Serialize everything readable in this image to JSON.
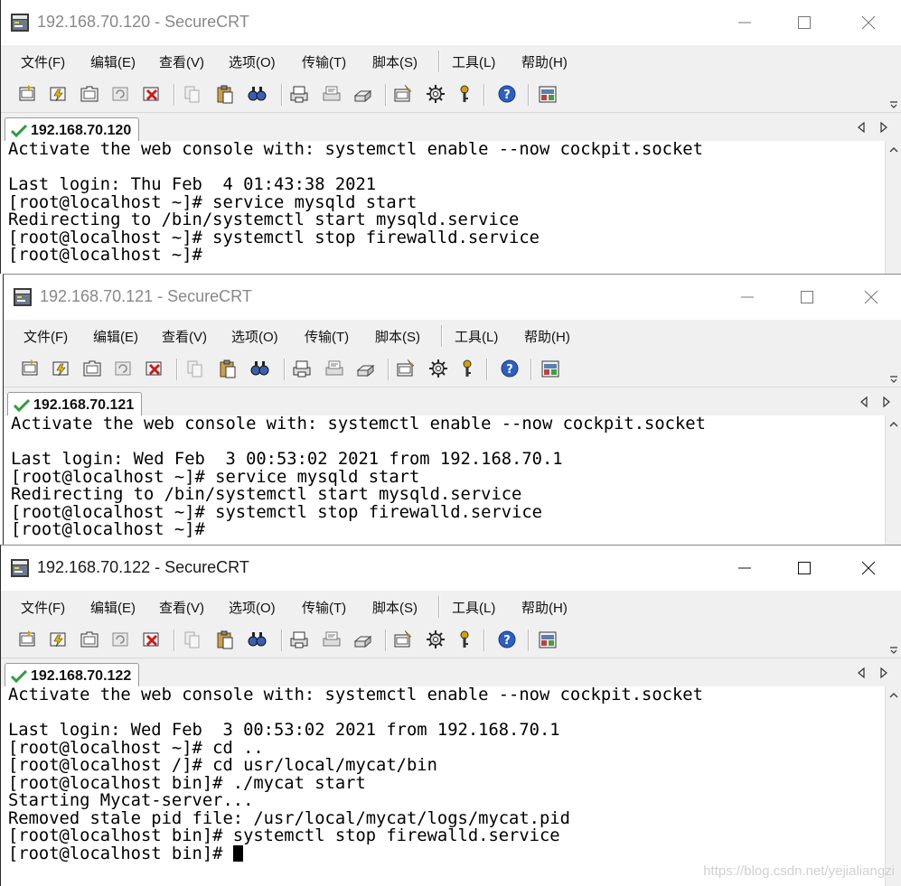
{
  "menu": [
    "文件(F)",
    "编辑(E)",
    "查看(V)",
    "选项(O)",
    "传输(T)",
    "脚本(S)",
    "工具(L)",
    "帮助(H)"
  ],
  "toolbar_icons": [
    "connect-icon",
    "quick-connect-icon",
    "connect-in-tab-icon",
    "reconnect-icon",
    "disconnect-icon",
    "copy-icon",
    "paste-icon",
    "find-icon",
    "print-icon",
    "print-selection-icon",
    "print-setup-icon",
    "session-options-icon",
    "global-options-icon",
    "key-map-icon",
    "help-icon",
    "sftp-icon"
  ],
  "colors": {
    "tab_check": "#2e9e3e",
    "terminal_bg": "#ffffff",
    "terminal_fg": "#000000",
    "chrome_bg": "#f0f0f0"
  },
  "windows": [
    {
      "title": "192.168.70.120 - SecureCRT",
      "tab": "192.168.70.120",
      "lines": [
        "Activate the web console with: systemctl enable --now cockpit.socket",
        "",
        "Last login: Thu Feb  4 01:43:38 2021",
        "[root@localhost ~]# service mysqld start",
        "Redirecting to /bin/systemctl start mysqld.service",
        "[root@localhost ~]# systemctl stop firewalld.service",
        "[root@localhost ~]#"
      ]
    },
    {
      "title": "192.168.70.121 - SecureCRT",
      "tab": "192.168.70.121",
      "lines": [
        "Activate the web console with: systemctl enable --now cockpit.socket",
        "",
        "Last login: Wed Feb  3 00:53:02 2021 from 192.168.70.1",
        "[root@localhost ~]# service mysqld start",
        "Redirecting to /bin/systemctl start mysqld.service",
        "[root@localhost ~]# systemctl stop firewalld.service",
        "[root@localhost ~]#"
      ]
    },
    {
      "title": "192.168.70.122 - SecureCRT",
      "tab": "192.168.70.122",
      "lines": [
        "Activate the web console with: systemctl enable --now cockpit.socket",
        "",
        "Last login: Wed Feb  3 00:53:02 2021 from 192.168.70.1",
        "[root@localhost ~]# cd ..",
        "[root@localhost /]# cd usr/local/mycat/bin",
        "[root@localhost bin]# ./mycat start",
        "Starting Mycat-server...",
        "Removed stale pid file: /usr/local/mycat/logs/mycat.pid",
        "[root@localhost bin]# systemctl stop firewalld.service",
        "[root@localhost bin]# "
      ]
    }
  ],
  "watermark": "https://blog.csdn.net/yejialiangzi"
}
